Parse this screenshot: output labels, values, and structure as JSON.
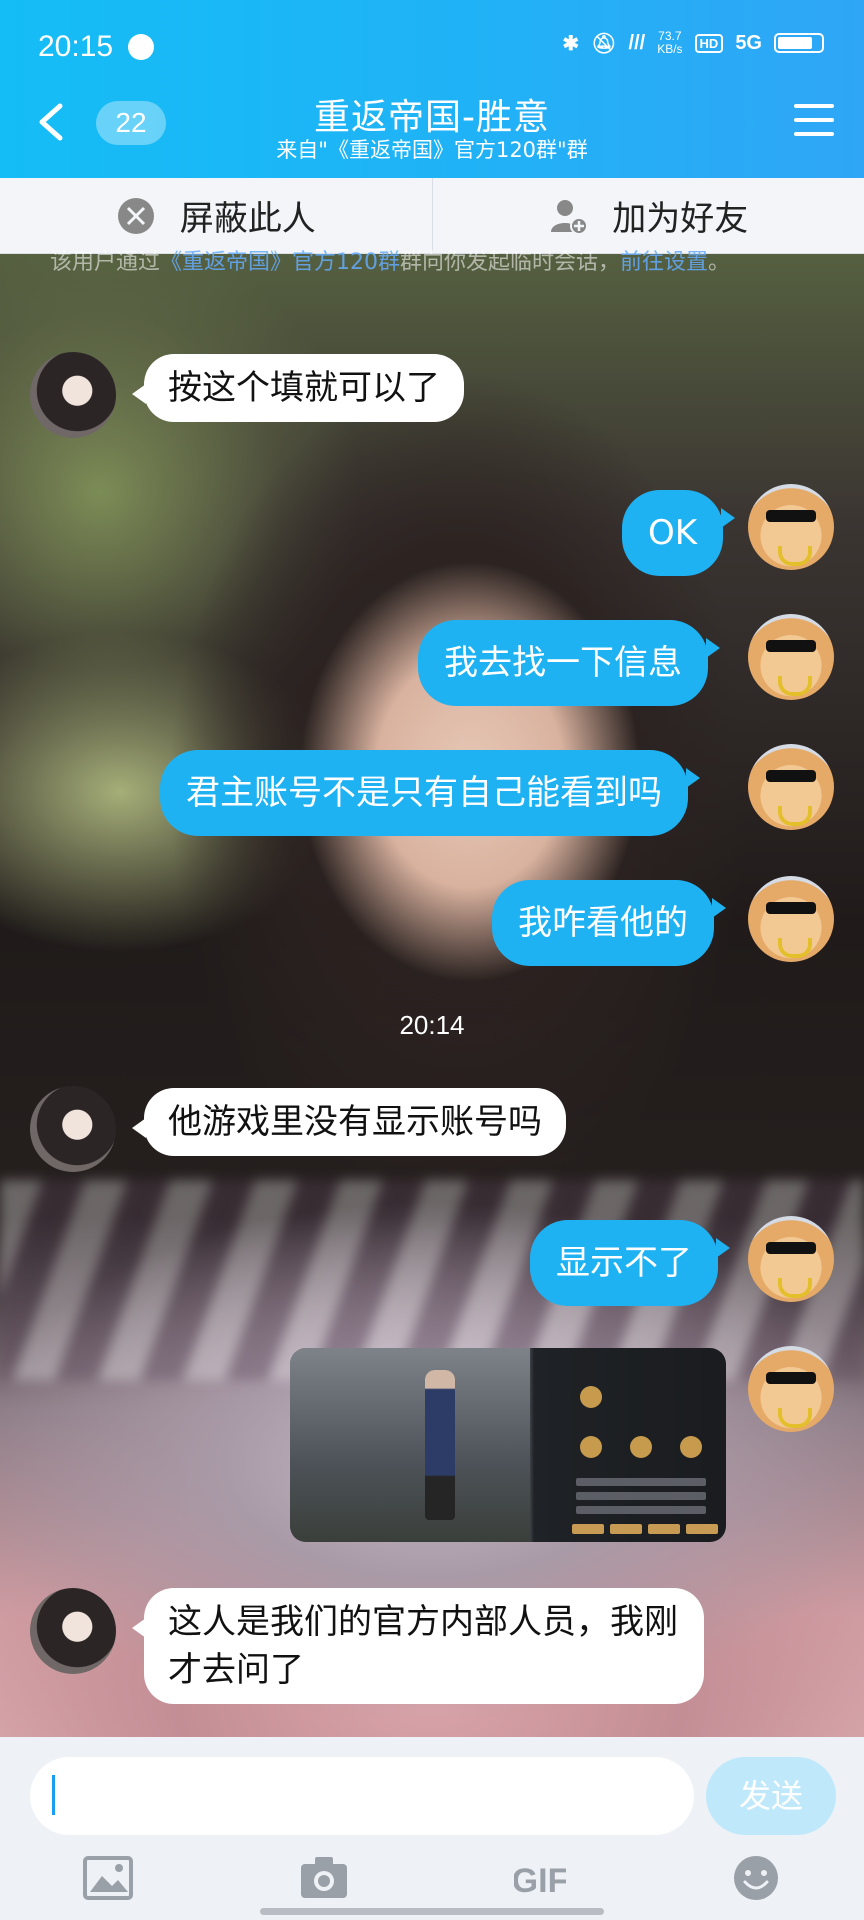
{
  "status_bar": {
    "time": "20:15",
    "speed_value": "73.7",
    "speed_unit": "KB/s",
    "hd": "HD",
    "net": "5G"
  },
  "header": {
    "unread_count": "22",
    "title": "重返帝国-胜意",
    "subtitle": "来自\"《重返帝国》官方120群\"群"
  },
  "actions": {
    "block": "屏蔽此人",
    "add_friend": "加为好友"
  },
  "notice": {
    "prefix": "该用户通过",
    "group_link": "《重返帝国》官方120群",
    "middle": "群向你发起临时会话，",
    "settings_link": "前往设置",
    "suffix": "。"
  },
  "messages": [
    {
      "side": "left",
      "text": "按这个填就可以了"
    },
    {
      "side": "right",
      "text": "OK"
    },
    {
      "side": "right",
      "text": "我去找一下信息"
    },
    {
      "side": "right",
      "text": "君主账号不是只有自己能看到吗"
    },
    {
      "side": "right",
      "text": "我咋看他的"
    },
    {
      "side": "time",
      "text": "20:14"
    },
    {
      "side": "left",
      "text": "他游戏里没有显示账号吗"
    },
    {
      "side": "right",
      "text": "显示不了"
    },
    {
      "side": "right",
      "type": "image",
      "text": ""
    },
    {
      "side": "left",
      "text": "这人是我们的官方内部人员，我刚才去问了"
    }
  ],
  "input": {
    "placeholder": "",
    "value": "",
    "send_label": "发送"
  },
  "toolbar_icons": [
    "image-icon",
    "camera-icon",
    "gif-icon",
    "emoji-icon"
  ],
  "colors": {
    "header": "#1fb3f6",
    "bubble_self": "#1fb2f3",
    "send_disabled": "#bfe9fb"
  }
}
